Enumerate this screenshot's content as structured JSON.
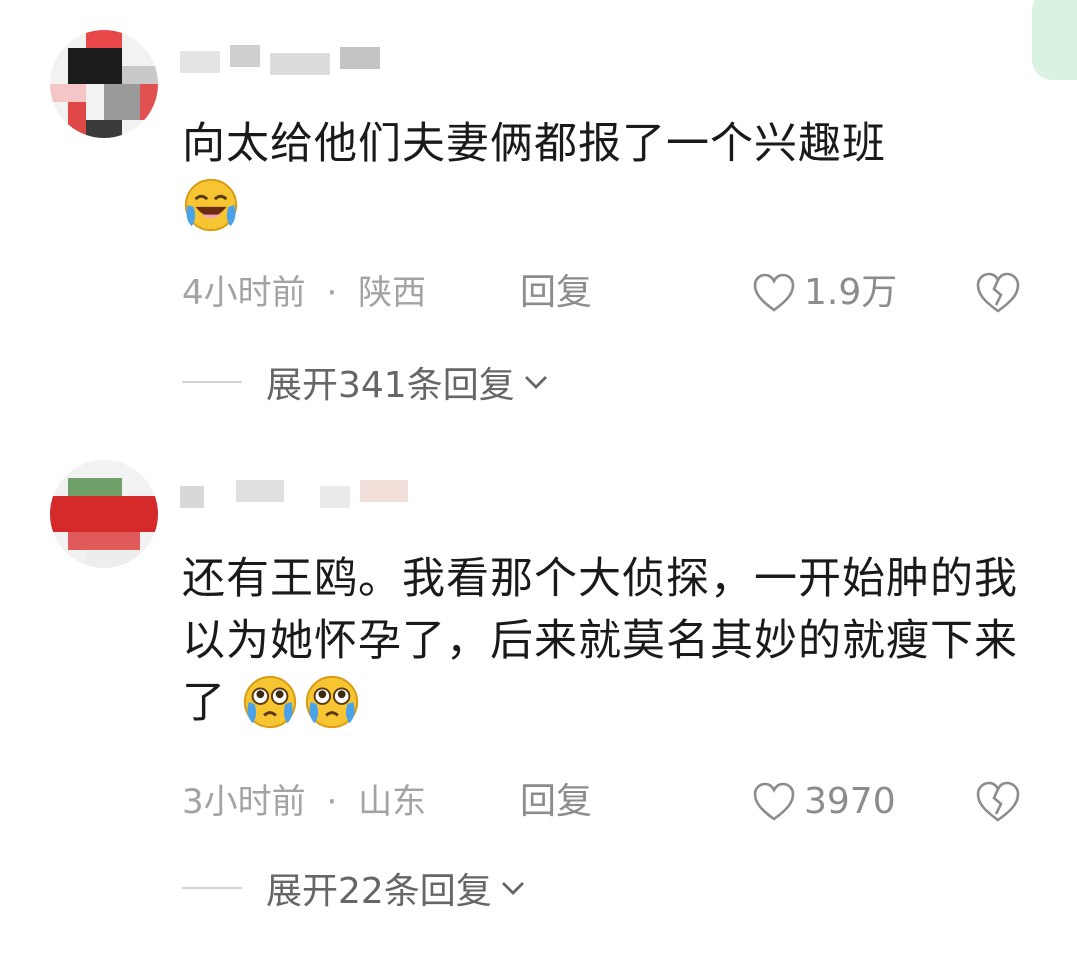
{
  "comments": [
    {
      "text": "向太给他们夫妻俩都报了一个兴趣班",
      "emojis": [
        "laugh-cry-emoji"
      ],
      "time": "4小时前",
      "separator": "·",
      "location": "陕西",
      "reply_label": "回复",
      "likes": "1.9万",
      "expand_label": "展开341条回复"
    },
    {
      "text": "还有王鸥。我看那个大侦探，一开始肿的我以为她怀孕了，后来就莫名其妙的就瘦下来了",
      "emojis": [
        "teary-eyes-emoji",
        "teary-eyes-emoji"
      ],
      "time": "3小时前",
      "separator": "·",
      "location": "山东",
      "reply_label": "回复",
      "likes": "3970",
      "expand_label": "展开22条回复"
    }
  ],
  "colors": {
    "text": "#1a1a1a",
    "meta": "#a3a3a3",
    "action": "#8c8c8c",
    "expand": "#666666",
    "emoji_yellow": "#f7c531",
    "tear_blue": "#4aa3e8"
  }
}
